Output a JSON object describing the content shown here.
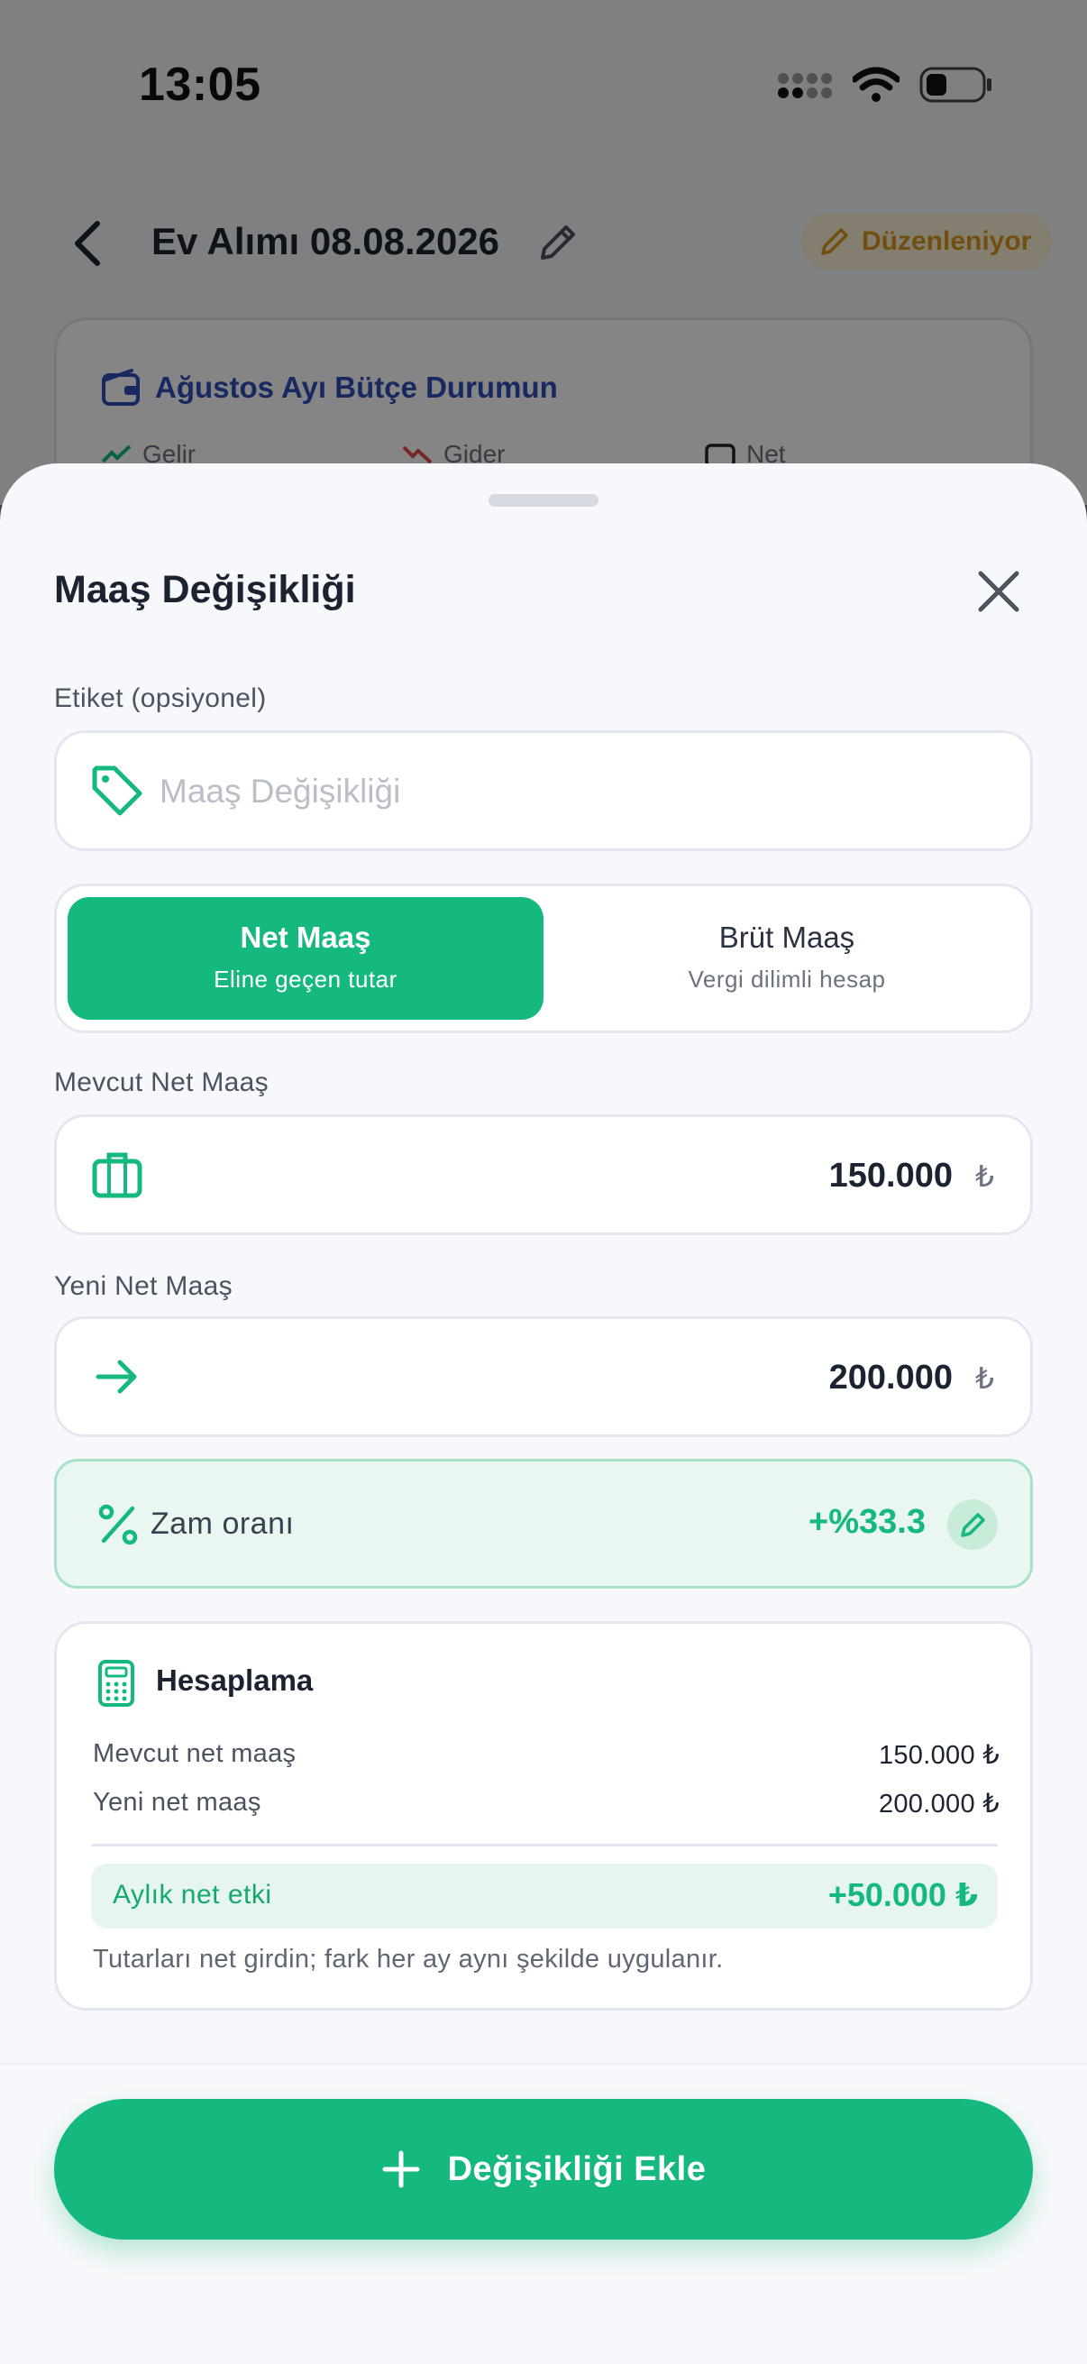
{
  "status_bar": {
    "time": "13:05"
  },
  "background_page": {
    "title": "Ev Alımı 08.08.2026",
    "badge": "Düzenleniyor",
    "budget_card": {
      "title": "Ağustos Ayı Bütçe Durumun",
      "income_label": "Gelir",
      "expense_label": "Gider",
      "net_label": "Net"
    }
  },
  "sheet": {
    "title": "Maaş Değişikliği",
    "label_field": {
      "label": "Etiket (opsiyonel)",
      "placeholder": "Maaş Değişikliği",
      "value": ""
    },
    "salary_type": {
      "selected": "net",
      "options": [
        {
          "key": "net",
          "title": "Net Maaş",
          "subtitle": "Eline geçen tutar"
        },
        {
          "key": "gross",
          "title": "Brüt Maaş",
          "subtitle": "Vergi dilimli hesap"
        }
      ]
    },
    "current_salary": {
      "label": "Mevcut Net Maaş",
      "value": "150.000",
      "currency": "₺"
    },
    "new_salary": {
      "label": "Yeni Net Maaş",
      "value": "200.000",
      "currency": "₺"
    },
    "raise_rate": {
      "label": "Zam oranı",
      "value": "+%33.3"
    },
    "calculation": {
      "title": "Hesaplama",
      "rows": [
        {
          "label": "Mevcut net maaş",
          "value": "150.000 ₺"
        },
        {
          "label": "Yeni net maaş",
          "value": "200.000 ₺"
        }
      ],
      "effect_label": "Aylık net etki",
      "effect_value": "+50.000 ₺",
      "note": "Tutarları net girdin; fark her ay aynı şekilde uygulanır."
    },
    "submit_label": "Değişikliği Ekle"
  },
  "colors": {
    "accent": "#15b97e",
    "warning": "#d99a1e",
    "link_blue": "#2d4fb8"
  }
}
